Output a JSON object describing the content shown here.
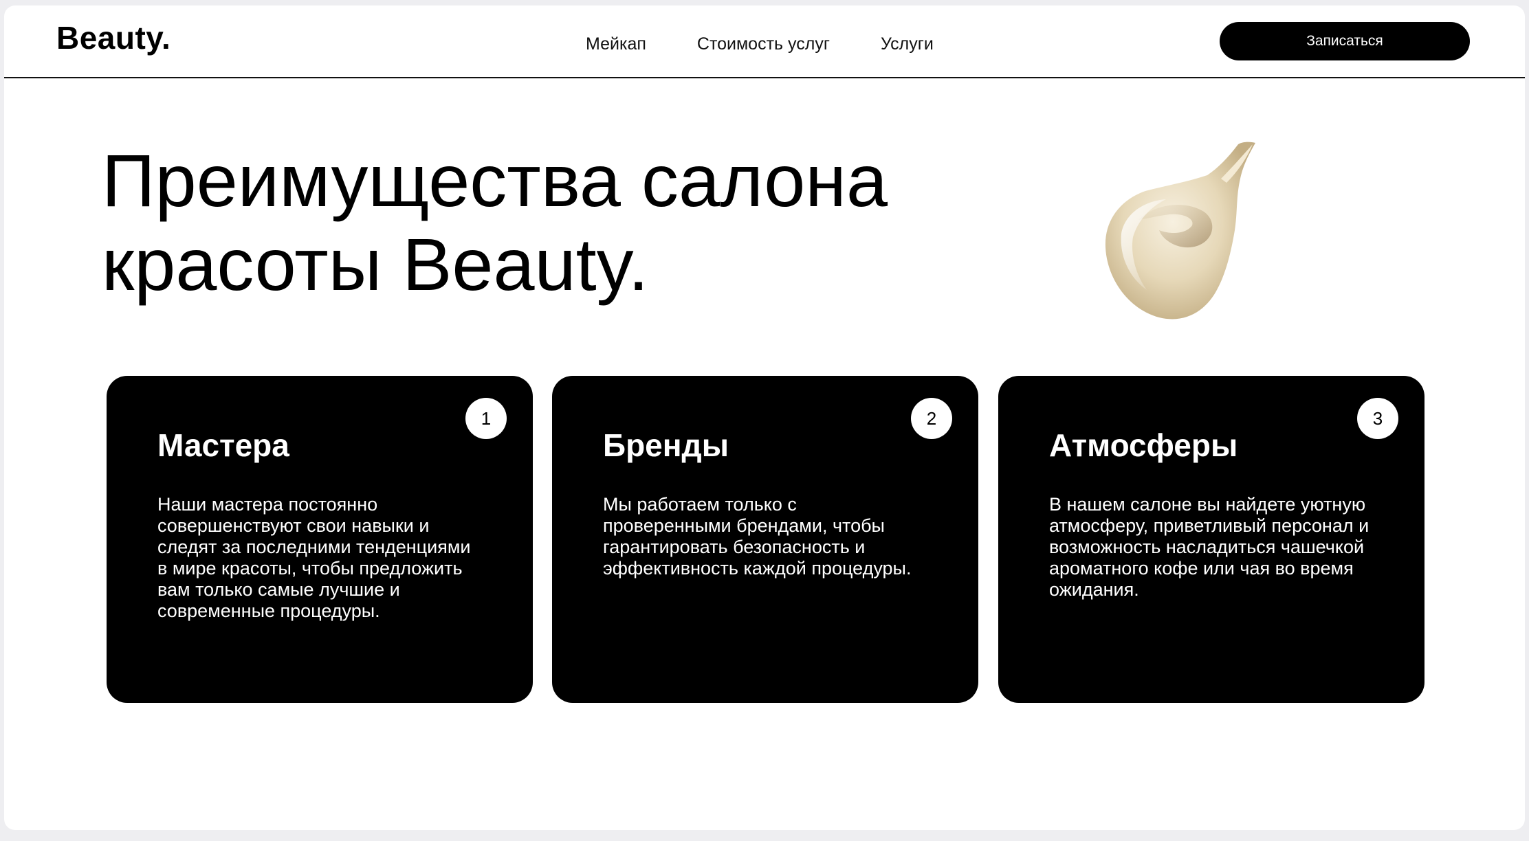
{
  "header": {
    "logo": "Beauty.",
    "nav": [
      {
        "label": "Мейкап"
      },
      {
        "label": "Стоимость услуг"
      },
      {
        "label": "Услуги"
      }
    ],
    "cta_label": "Записаться"
  },
  "hero": {
    "title_line1": "Преимущества салона",
    "title_line2": "красоты Beauty."
  },
  "cards": [
    {
      "number": "1",
      "title": "Мастера",
      "text": "Наши мастера постоянно совершенствуют свои навыки и следят за последними тенденциями в мире красоты, чтобы предложить вам только самые лучшие и современные процедуры."
    },
    {
      "number": "2",
      "title": "Бренды",
      "text": "Мы работаем только с проверенными брендами, чтобы гарантировать безопасность и эффективность каждой процедуры."
    },
    {
      "number": "3",
      "title": "Атмосферы",
      "text": "В нашем салоне вы найдете уютную атмосферу, приветливый персонал и возможность насладиться чашечкой ароматного кофе или чая во время ожидания."
    }
  ],
  "colors": {
    "page_background": "#ffffff",
    "outer_background": "#eeeef1",
    "card_background": "#000000",
    "accent": "#000000",
    "text_on_dark": "#ffffff",
    "cream": "#e8dcc4"
  },
  "icons": {
    "decoration": "cream-swatch-image"
  }
}
